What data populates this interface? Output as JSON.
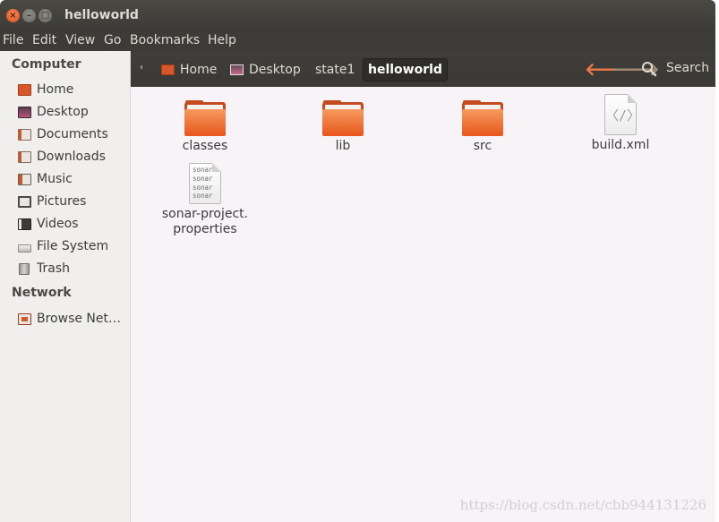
{
  "window": {
    "title": "helloworld",
    "close_glyph": "×",
    "min_glyph": "–",
    "max_glyph": "□"
  },
  "menu": [
    "File",
    "Edit",
    "View",
    "Go",
    "Bookmarks",
    "Help"
  ],
  "sidebar": {
    "computer_heading": "Computer",
    "computer_items": [
      {
        "label": "Home",
        "icon": "home-folder-icon"
      },
      {
        "label": "Desktop",
        "icon": "desktop-icon"
      },
      {
        "label": "Documents",
        "icon": "documents-folder-icon"
      },
      {
        "label": "Downloads",
        "icon": "downloads-folder-icon"
      },
      {
        "label": "Music",
        "icon": "music-folder-icon"
      },
      {
        "label": "Pictures",
        "icon": "pictures-folder-icon"
      },
      {
        "label": "Videos",
        "icon": "videos-folder-icon"
      },
      {
        "label": "File System",
        "icon": "drive-icon"
      },
      {
        "label": "Trash",
        "icon": "trash-icon"
      }
    ],
    "network_heading": "Network",
    "network_items": [
      {
        "label": "Browse Net…",
        "icon": "network-folder-icon"
      }
    ]
  },
  "toolbar": {
    "crumb_scroll_glyph": "‹",
    "breadcrumbs": [
      "Home",
      "Desktop",
      "state1",
      "helloworld"
    ],
    "back_glyph": "🡐",
    "forward_glyph": "🡒",
    "search_label": "Search"
  },
  "files": [
    {
      "name": "classes",
      "type": "folder"
    },
    {
      "name": "lib",
      "type": "folder"
    },
    {
      "name": "src",
      "type": "folder"
    },
    {
      "name": "build.xml",
      "type": "xml",
      "glyph": "〈/〉"
    },
    {
      "name_line1": "sonar-project.",
      "name_line2": "properties",
      "type": "text",
      "preview": [
        "sonar",
        "sonar",
        "sonar",
        "sonar"
      ]
    }
  ],
  "watermark": "https://blog.csdn.net/cbb944131226",
  "colors": {
    "accent_orange": "#f07746",
    "titlebar": "#3c3b37",
    "sidebar_bg": "#f0efed",
    "content_bg": "#f7f3f6"
  }
}
